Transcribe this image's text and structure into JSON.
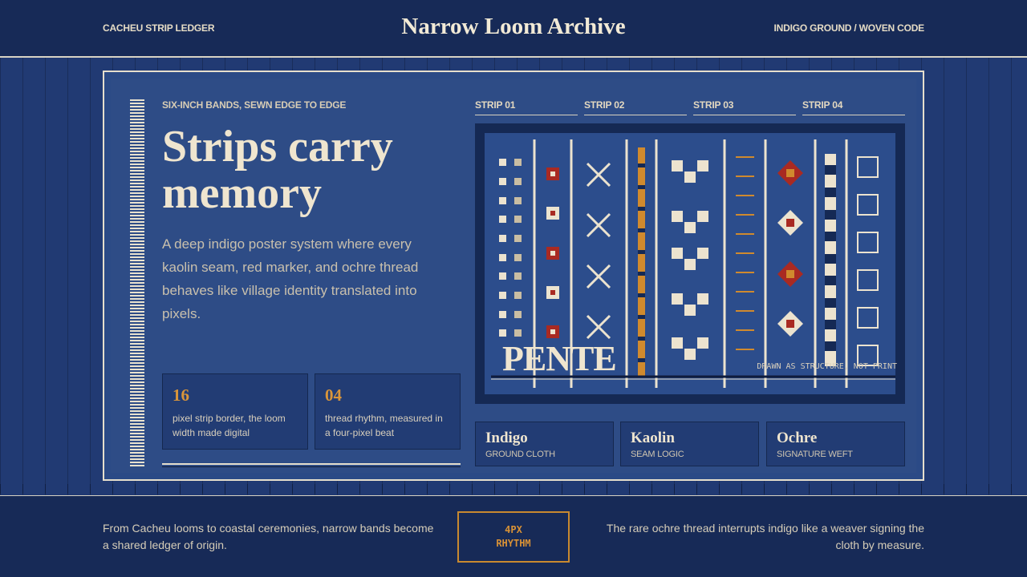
{
  "header": {
    "left": "CACHEU STRIP LEDGER",
    "title": "Narrow Loom Archive",
    "right": "INDIGO GROUND / WOVEN CODE"
  },
  "hero": {
    "eyebrow": "SIX-INCH BANDS, SEWN EDGE TO EDGE",
    "title": "Strips carry memory",
    "body": "A deep indigo poster system where every kaolin seam, red marker, and ochre thread behaves like village identity translated into pixels."
  },
  "stats": [
    {
      "value": "16",
      "label": "pixel strip border, the loom width made digital"
    },
    {
      "value": "04",
      "label": "thread rhythm, measured in a four-pixel beat"
    }
  ],
  "strips": [
    "STRIP 01",
    "STRIP 02",
    "STRIP 03",
    "STRIP 04"
  ],
  "loom": {
    "word": "PENTE",
    "caption": "DRAWN AS STRUCTURE, NOT PRINT"
  },
  "swatches": [
    {
      "name": "Indigo",
      "sub": "GROUND CLOTH"
    },
    {
      "name": "Kaolin",
      "sub": "SEAM LOGIC"
    },
    {
      "name": "Ochre",
      "sub": "SIGNATURE WEFT"
    }
  ],
  "footer": {
    "left": "From Cacheu looms to coastal ceremonies, narrow bands become a shared ledger of origin.",
    "badge_line1": "4PX",
    "badge_line2": "RHYTHM",
    "right": "The rare ochre thread interrupts indigo like a weaver signing the cloth by measure."
  },
  "colors": {
    "indigo": "#2c4d8c",
    "kaolin": "#ece3cf",
    "ochre": "#d08a2e",
    "red": "#a92a22"
  }
}
